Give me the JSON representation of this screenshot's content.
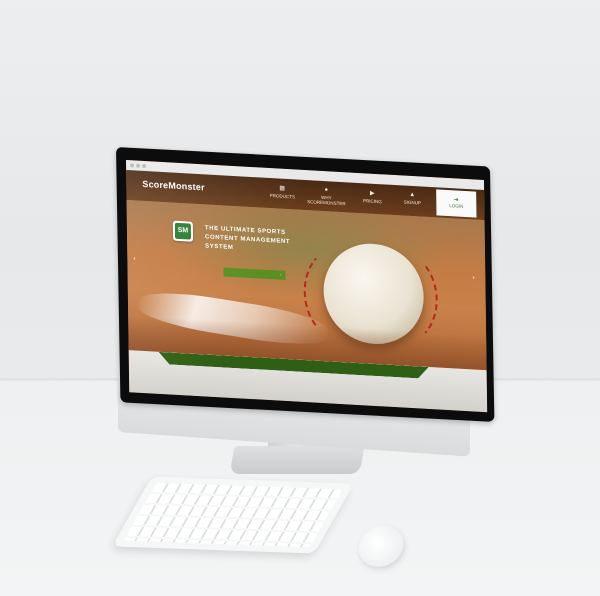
{
  "site": {
    "logo": "ScoreMonster",
    "badge": "SM",
    "tagline_line1": "THE ULTIMATE SPORTS",
    "tagline_line2": "CONTENT MANAGEMENT SYSTEM",
    "features": [
      "",
      "",
      "",
      ""
    ],
    "cta_label": "",
    "nav": [
      {
        "icon": "grid-icon",
        "glyph": "▦",
        "label": "PRODUCTS"
      },
      {
        "icon": "info-icon",
        "glyph": "●",
        "label": "WHY SCOREMONSTER"
      },
      {
        "icon": "tag-icon",
        "glyph": "▶",
        "label": "PRICING"
      },
      {
        "icon": "home-icon",
        "glyph": "▲",
        "label": "SIGNUP"
      }
    ],
    "login": {
      "icon": "login-icon",
      "glyph": "➜",
      "label": "LOGIN"
    },
    "band_tabs": [
      "",
      "",
      ""
    ]
  },
  "device": {
    "apple_glyph": ""
  },
  "colors": {
    "accent": "#5b8f22",
    "band": "#2f5f14",
    "nav": "#4a2a14"
  }
}
